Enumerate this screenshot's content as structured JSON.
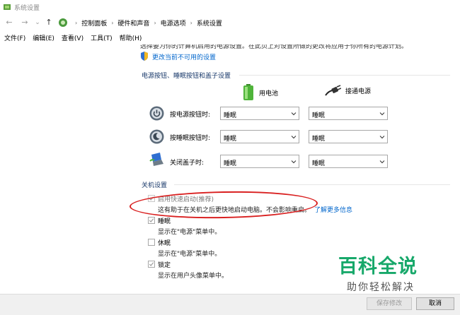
{
  "window": {
    "title": "系统设置"
  },
  "nav": {
    "back": "←",
    "forward": "→",
    "dropdown": "⌄",
    "up": "↑"
  },
  "breadcrumb": [
    "控制面板",
    "硬件和声音",
    "电源选项",
    "系统设置"
  ],
  "menu": [
    "文件(F)",
    "编辑(E)",
    "查看(V)",
    "工具(T)",
    "帮助(H)"
  ],
  "intro_cut": "选择要为你的计算机启用的电源设置。在此页上对设置所做的更改将应用于你所有的电源计划。",
  "change_link": "更改当前不可用的设置",
  "power_section": {
    "title": "电源按钮、睡眠按钮和盖子设置",
    "col_battery": "用电池",
    "col_plugged": "接通电源",
    "rows": [
      {
        "label": "按电源按钮时:",
        "battery": "睡眠",
        "plugged": "睡眠"
      },
      {
        "label": "按睡眠按钮时:",
        "battery": "睡眠",
        "plugged": "睡眠"
      },
      {
        "label": "关闭盖子时:",
        "battery": "睡眠",
        "plugged": "睡眠"
      }
    ]
  },
  "shutdown_section": {
    "title": "关机设置",
    "items": [
      {
        "label": "启用快速启动(推荐)",
        "desc": "这有助于在关机之后更快地启动电脑。不会影响重启。",
        "link": "了解更多信息",
        "checked": true
      },
      {
        "label": "睡眠",
        "desc": "显示在\"电源\"菜单中。",
        "checked": true
      },
      {
        "label": "休眠",
        "desc": "显示在\"电源\"菜单中。",
        "checked": false
      },
      {
        "label": "锁定",
        "desc": "显示在用户头像菜单中。",
        "checked": true
      }
    ]
  },
  "buttons": {
    "save": "保存修改",
    "cancel": "取消"
  },
  "watermark": {
    "main": "百科全说",
    "sub": "助你轻松解决"
  },
  "colors": {
    "accent": "#0066cc",
    "section_title": "#1a3a6b",
    "highlight_oval": "#d92020",
    "watermark": "#17a86a"
  }
}
